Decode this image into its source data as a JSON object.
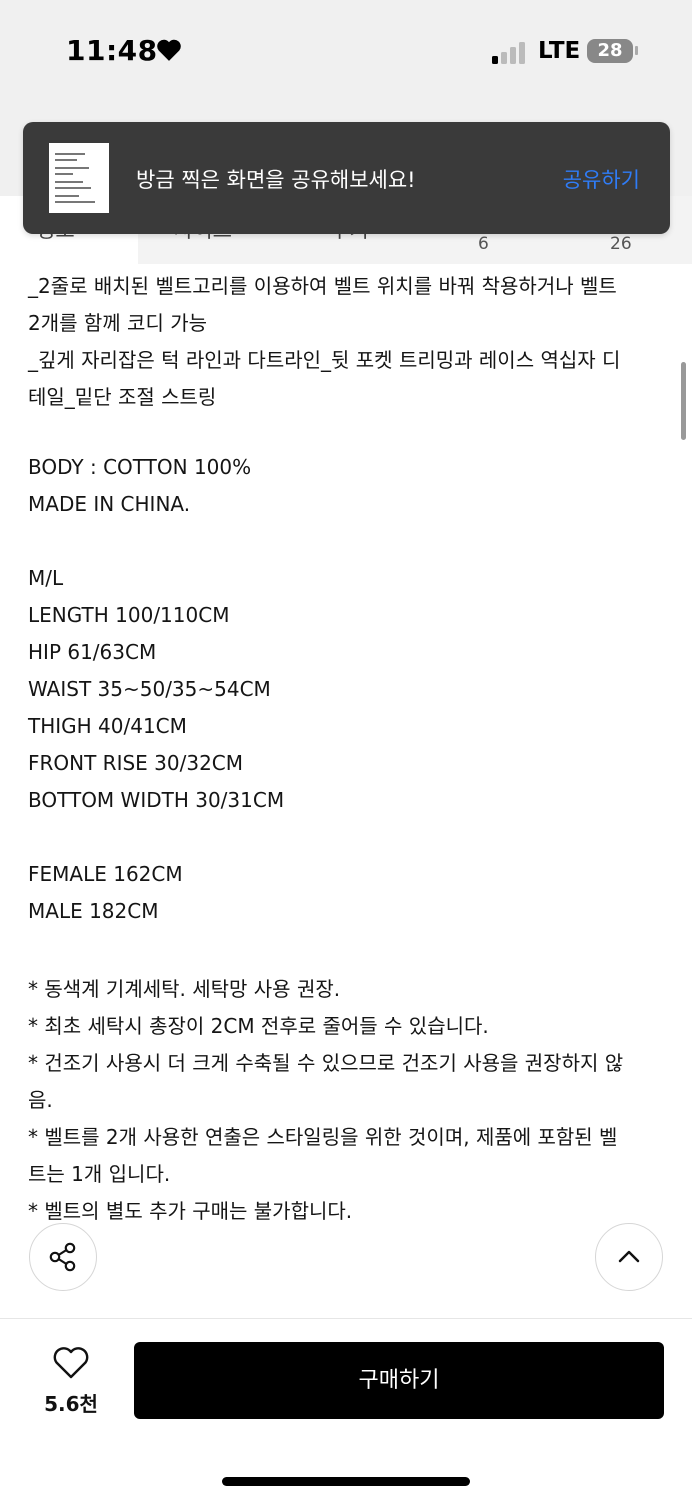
{
  "status_bar": {
    "time": "11:48",
    "network": "LTE",
    "battery": "28"
  },
  "tabs": [
    {
      "label": "정보",
      "count": ""
    },
    {
      "label": "사이즈",
      "count": "6"
    },
    {
      "label": "후기",
      "count": "26"
    }
  ],
  "toast": {
    "message": "방금 찍은 화면을 공유해보세요!",
    "action": "공유하기"
  },
  "description_lines": [
    "_2줄로 배치된 벨트고리를 이용하여 벨트 위치를 바꿔 착용하거나 벨트",
    "2개를 함께 코디 가능",
    "_깊게 자리잡은 턱 라인과 다트라인_뒷 포켓 트리밍과 레이스 역십자 디",
    "테일_밑단 조절 스트링",
    "",
    "BODY : COTTON 100%",
    "MADE IN CHINA.",
    "",
    "M/L",
    "LENGTH 100/110CM",
    "HIP 61/63CM",
    "WAIST 35~50/35~54CM",
    "THIGH 40/41CM",
    "FRONT RISE 30/32CM",
    "BOTTOM WIDTH 30/31CM",
    "",
    "FEMALE 162CM",
    "MALE 182CM",
    "",
    "* 동색계 기계세탁. 세탁망 사용 권장.",
    "* 최초 세탁시 총장이 2CM 전후로 줄어들 수 있습니다.",
    "* 건조기 사용시 더 크게 수축될 수 있으므로 건조기 사용을 권장하지 않",
    "음.",
    "* 벨트를 2개 사용한 연출은 스타일링을 위한 것이며, 제품에 포함된 벨",
    "트는 1개 입니다.",
    "* 벨트의 별도 추가 구매는 불가합니다."
  ],
  "bottom_bar": {
    "like_count": "5.6천",
    "buy_label": "구매하기"
  },
  "icons": {
    "share": "share-icon",
    "scroll_top": "chevron-up-icon",
    "like": "heart-outline-icon"
  }
}
